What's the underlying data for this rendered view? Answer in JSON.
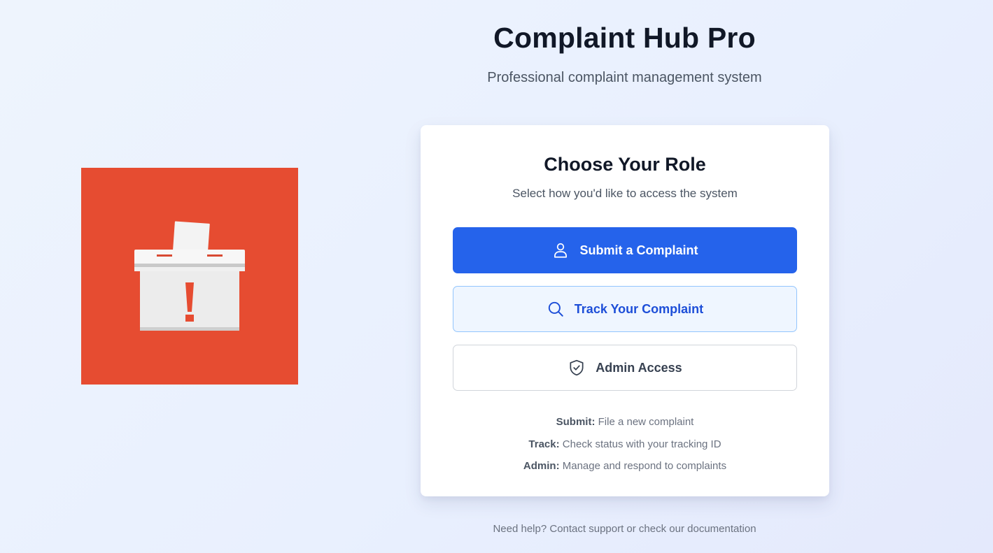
{
  "header": {
    "title": "Complaint Hub Pro",
    "subtitle": "Professional complaint management system"
  },
  "logo": {
    "icon": "ballot-box-exclamation-icon",
    "background_color": "#e64c31"
  },
  "card": {
    "title": "Choose Your Role",
    "subtitle": "Select how you'd like to access the system",
    "buttons": {
      "submit": {
        "label": "Submit a Complaint",
        "icon": "user-icon"
      },
      "track": {
        "label": "Track Your Complaint",
        "icon": "search-icon"
      },
      "admin": {
        "label": "Admin Access",
        "icon": "shield-check-icon"
      }
    },
    "help": [
      {
        "term": "Submit:",
        "desc": "File a new complaint"
      },
      {
        "term": "Track:",
        "desc": "Check status with your tracking ID"
      },
      {
        "term": "Admin:",
        "desc": "Manage and respond to complaints"
      }
    ]
  },
  "footer": {
    "text": "Need help? Contact support or check our documentation"
  },
  "colors": {
    "primary": "#2563eb",
    "track_bg": "#eff6ff",
    "track_border": "#93c5fd",
    "brand_red": "#e64c31"
  }
}
